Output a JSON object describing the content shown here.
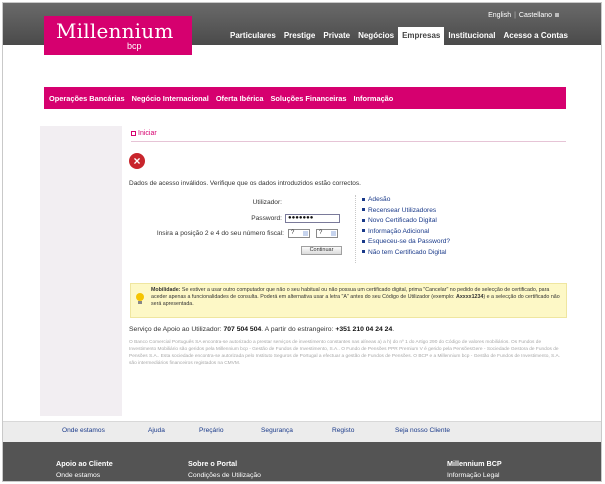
{
  "languages": [
    "English",
    "Castellano"
  ],
  "brand": {
    "name": "Millennium",
    "sub": "bcp",
    "color": "#d6006f"
  },
  "main_nav": [
    {
      "label": "Particulares",
      "active": false
    },
    {
      "label": "Prestige",
      "active": false
    },
    {
      "label": "Private",
      "active": false
    },
    {
      "label": "Negócios",
      "active": false
    },
    {
      "label": "Empresas",
      "active": true
    },
    {
      "label": "Institucional",
      "active": false
    },
    {
      "label": "Acesso a Contas",
      "active": false
    }
  ],
  "section_nav": [
    "Operações Bancárias",
    "Negócio Internacional",
    "Oferta Ibérica",
    "Soluções Financeiras",
    "Informação"
  ],
  "breadcrumb": "Iniciar",
  "error_icon": "error-x-icon",
  "error_message": "Dados de acesso inválidos. Verifique que os dados introduzidos estão correctos.",
  "login": {
    "utilizador_label": "Utilizador:",
    "password_label": "Password:",
    "password_value": "●●●●●●●",
    "nif_label": "Insira a posição 2 e 4 do seu número fiscal:",
    "nif_select_1": "?",
    "nif_select_2": "?",
    "continue_label": "Continuar"
  },
  "side_links": [
    "Adesão",
    "Recensear Utilizadores",
    "Novo Certificado Digital",
    "Informação Adicional",
    "Esqueceu-se da Password?",
    "Não tem Certificado Digital"
  ],
  "mobility": {
    "title": "Mobilidade:",
    "text": "Se estiver a usar outro computador que não o seu habitual ou não possua um certificado digital, prima \"Cancelar\" no pedido de selecção de certificado, para aceder apenas a funcionalidades de consulta. Poderá em alternativa usar a letra \"A\" antes do seu Código de Utilizador (exemplo:",
    "example": "Axxxx1234",
    "tail": ") e a selecção do certificado não será apresentada."
  },
  "support": {
    "prefix": "Serviço de Apoio ao Utilizador:",
    "phone": "707 504 504",
    "mid": ". A partir do estrangeiro:",
    "intl": "+351 210 04 24 24",
    "end": "."
  },
  "legal_text": "O Banco Comercial Português SA encontra-se autorizado a prestar serviços de investimento constantes nas alíneas a) a h) do nº 1 do Artigo 290 do Código de valores mobiliários. Os Fundos de Investimento Mobiliário são geridos pela Millennium bcp - Gestão de Fundos de Investimento, S.A.. O Fundo de Pensões PPR Premium V é gerido pela PensõesGere - Sociedade Gestora de Fundos de Pensões S.A.. Esta sociedade encontra-se autorizada pelo Instituto Seguros de Portugal a efectuar a gestão de Fundos de Pensões. O BCP e a Millennium bcp - Gestão de Fundos de Investimento, S.A. são intermediários financeiros registados na CMVM.",
  "footer_links": [
    "Onde estamos",
    "Ajuda",
    "Preçário",
    "Segurança",
    "Registo",
    "Seja nosso Cliente"
  ],
  "footer_columns": [
    {
      "heading": "Apoio ao Cliente",
      "item": "Onde estamos"
    },
    {
      "heading": "Sobre o Portal",
      "item": "Condições de Utilização"
    },
    {
      "heading": "Millennium BCP",
      "item": "Informação Legal"
    }
  ]
}
